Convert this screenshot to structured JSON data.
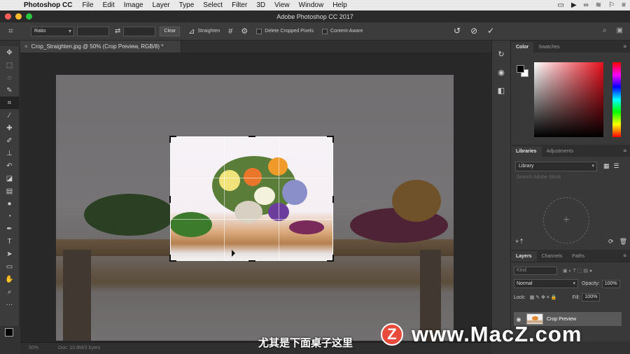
{
  "menubar": {
    "apple": "",
    "app": "Photoshop CC",
    "items": [
      "File",
      "Edit",
      "Image",
      "Layer",
      "Type",
      "Select",
      "Filter",
      "3D",
      "View",
      "Window",
      "Help"
    ],
    "status_icons": [
      "display-icon",
      "video-icon",
      "creative-cloud-icon",
      "wifi-icon",
      "bell-icon",
      "menu-icon"
    ]
  },
  "window": {
    "title": "Adobe Photoshop CC 2017",
    "lights": [
      "#ff5f57",
      "#febc2e",
      "#28c840"
    ]
  },
  "options": {
    "ratio": "Ratio",
    "clear": "Clear",
    "straighten": "Straighten",
    "delete_cropped": "Delete Cropped Pixels",
    "content_aware": "Content-Aware"
  },
  "document": {
    "tab_title": "Crop_Straighten.jpg @ 50% (Crop Preview, RGB/8) *",
    "close_glyph": "×"
  },
  "tools": [
    "move",
    "marquee",
    "lasso",
    "quick-select",
    "crop",
    "eyedropper",
    "healing",
    "brush",
    "stamp",
    "history-brush",
    "eraser",
    "gradient",
    "blur",
    "dodge",
    "pen",
    "type",
    "path-select",
    "shape",
    "hand",
    "zoom",
    "more"
  ],
  "panels": {
    "color_tabs": [
      "Color",
      "Swatches"
    ],
    "library_tabs": [
      "Libraries",
      "Adjustments"
    ],
    "library_select": "Library",
    "library_search": "Search Adobe Stock",
    "layers_tabs": [
      "Layers",
      "Channels",
      "Paths"
    ],
    "kind": "Kind",
    "blend_mode": "Normal",
    "opacity_label": "Opacity:",
    "opacity_value": "100%",
    "lock_label": "Lock:",
    "fill_label": "Fill:",
    "fill_value": "100%",
    "layer_name": "Crop Preview"
  },
  "status": {
    "zoom": "50%",
    "doc": "Doc: 10.8M/3 bytes"
  },
  "overlay": {
    "subtitle": "尤其是下面桌子这里",
    "watermark_letter": "Z",
    "watermark_text": "www.MacZ.com"
  }
}
